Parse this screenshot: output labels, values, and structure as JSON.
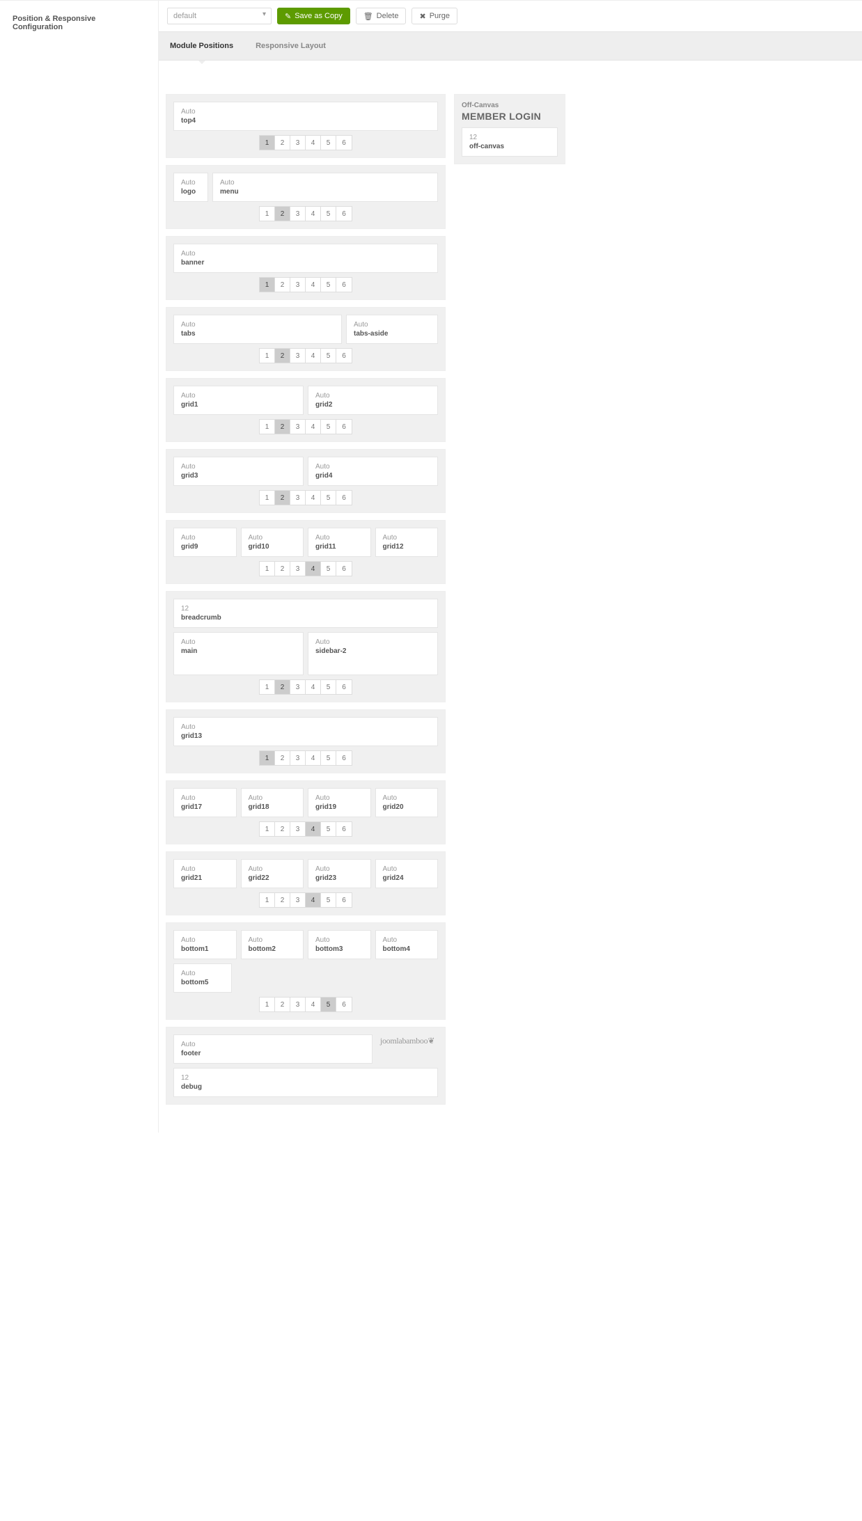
{
  "sidebar": {
    "title": "Position & Responsive Configuration"
  },
  "toolbar": {
    "select_value": "default",
    "save_label": "Save as Copy",
    "delete_label": "Delete",
    "purge_label": "Purge"
  },
  "tabs": {
    "module": "Module Positions",
    "responsive": "Responsive Layout"
  },
  "labels": {
    "auto": "Auto",
    "twelve": "12"
  },
  "positions": {
    "top4": "top4",
    "logo": "logo",
    "menu": "menu",
    "banner": "banner",
    "tabs": "tabs",
    "tabs_aside": "tabs-aside",
    "grid1": "grid1",
    "grid2": "grid2",
    "grid3": "grid3",
    "grid4": "grid4",
    "grid9": "grid9",
    "grid10": "grid10",
    "grid11": "grid11",
    "grid12": "grid12",
    "breadcrumb": "breadcrumb",
    "main": "main",
    "sidebar2": "sidebar-2",
    "grid13": "grid13",
    "grid17": "grid17",
    "grid18": "grid18",
    "grid19": "grid19",
    "grid20": "grid20",
    "grid21": "grid21",
    "grid22": "grid22",
    "grid23": "grid23",
    "grid24": "grid24",
    "bottom1": "bottom1",
    "bottom2": "bottom2",
    "bottom3": "bottom3",
    "bottom4": "bottom4",
    "bottom5": "bottom5",
    "footer": "footer",
    "debug": "debug",
    "offcanvas": "off-canvas"
  },
  "offcanvas": {
    "title": "Off-Canvas",
    "heading": "MEMBER LOGIN"
  },
  "pager": {
    "p1": "1",
    "p2": "2",
    "p3": "3",
    "p4": "4",
    "p5": "5",
    "p6": "6"
  },
  "brand": "joomlabamboo"
}
